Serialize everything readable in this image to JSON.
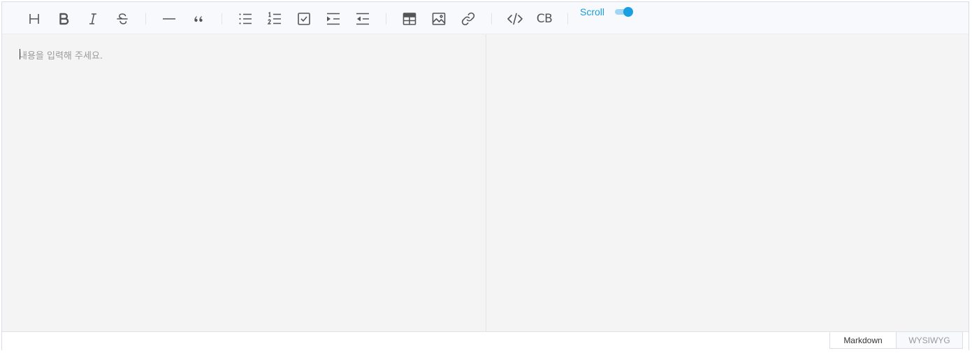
{
  "toolbar": {
    "items": [
      {
        "name": "heading-icon",
        "title": "Headings"
      },
      {
        "name": "bold-icon",
        "title": "Bold"
      },
      {
        "name": "italic-icon",
        "title": "Italic"
      },
      {
        "name": "strike-icon",
        "title": "Strike"
      },
      {
        "name": "horizontal-line-icon",
        "title": "Line"
      },
      {
        "name": "blockquote-icon",
        "title": "Blockquote"
      },
      {
        "name": "bullet-list-icon",
        "title": "Unordered list"
      },
      {
        "name": "ordered-list-icon",
        "title": "Ordered list"
      },
      {
        "name": "task-list-icon",
        "title": "Task"
      },
      {
        "name": "indent-icon",
        "title": "Indent"
      },
      {
        "name": "outdent-icon",
        "title": "Outdent"
      },
      {
        "name": "table-icon",
        "title": "Insert table"
      },
      {
        "name": "image-icon",
        "title": "Insert image"
      },
      {
        "name": "link-icon",
        "title": "Insert link"
      },
      {
        "name": "code-icon",
        "title": "Code"
      },
      {
        "name": "code-block-icon",
        "title": "Insert CodeBlock"
      }
    ],
    "code_block_label": "CB",
    "scroll_sync": {
      "label": "Scroll",
      "enabled": true,
      "accent_color": "#1aa0e0"
    }
  },
  "markdown": {
    "placeholder": "내용을 입력해 주세요.",
    "value": ""
  },
  "mode_switch": {
    "markdown_label": "Markdown",
    "wysiwyg_label": "WYSIWYG",
    "active": "Markdown"
  }
}
